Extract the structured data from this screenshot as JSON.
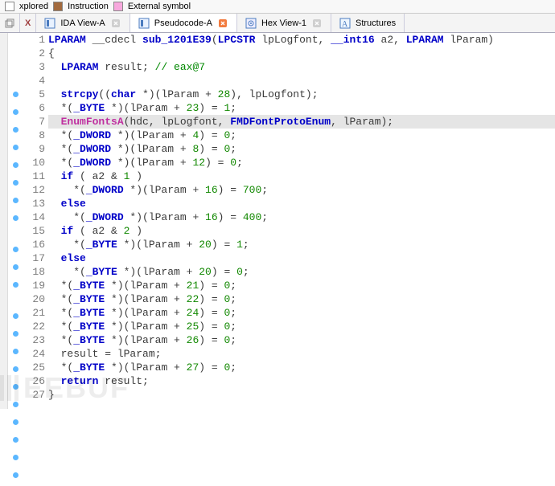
{
  "topbar": {
    "items": [
      {
        "color": "#ffffff",
        "label": "xplored"
      },
      {
        "color": "#a26a3e",
        "label": "Instruction"
      },
      {
        "color": "#f7a8dd",
        "label": "External symbol"
      }
    ]
  },
  "tabs": [
    {
      "id": "ida-view",
      "label": "IDA View-A",
      "icon": "blue",
      "close_color": "#cfcfcf",
      "active": false
    },
    {
      "id": "pseudocode",
      "label": "Pseudocode-A",
      "icon": "blue",
      "close_color": "#f27b3e",
      "active": true
    },
    {
      "id": "hex-view",
      "label": "Hex View-1",
      "icon": "target",
      "close_color": "#cfcfcf",
      "active": false
    },
    {
      "id": "structures",
      "label": "Structures",
      "icon": "struct",
      "close_color": "",
      "active": false
    }
  ],
  "left_extra_close": "X",
  "code": {
    "lines": [
      {
        "n": 1,
        "dot": false,
        "hl": false,
        "tokens": [
          [
            "fn",
            "LPARAM"
          ],
          [
            "txt",
            " __cdecl "
          ],
          [
            "fn",
            "sub_1201E39"
          ],
          [
            "txt",
            "("
          ],
          [
            "kw",
            "LPCSTR"
          ],
          [
            "txt",
            " "
          ],
          [
            "txt",
            "lpLogfont, "
          ],
          [
            "kw",
            "__int16"
          ],
          [
            "txt",
            " a2, "
          ],
          [
            "kw",
            "LPARAM"
          ],
          [
            "txt",
            " lParam)"
          ]
        ]
      },
      {
        "n": 2,
        "dot": false,
        "hl": false,
        "tokens": [
          [
            "txt",
            "{"
          ]
        ]
      },
      {
        "n": 3,
        "dot": false,
        "hl": false,
        "tokens": [
          [
            "txt",
            "  "
          ],
          [
            "kw",
            "LPARAM"
          ],
          [
            "txt",
            " result; "
          ],
          [
            "cmt",
            "// eax@7"
          ]
        ]
      },
      {
        "n": 4,
        "dot": false,
        "hl": false,
        "tokens": [
          [
            "txt",
            " "
          ]
        ]
      },
      {
        "n": 5,
        "dot": true,
        "hl": false,
        "tokens": [
          [
            "txt",
            "  "
          ],
          [
            "fn",
            "strcpy"
          ],
          [
            "txt",
            "(("
          ],
          [
            "kw",
            "char"
          ],
          [
            "txt",
            " *)(lParam + "
          ],
          [
            "num",
            "28"
          ],
          [
            "txt",
            "), lpLogfont);"
          ]
        ]
      },
      {
        "n": 6,
        "dot": true,
        "hl": false,
        "tokens": [
          [
            "txt",
            "  *("
          ],
          [
            "kwt",
            "_BYTE"
          ],
          [
            "txt",
            " *)(lParam + "
          ],
          [
            "num",
            "23"
          ],
          [
            "txt",
            ") = "
          ],
          [
            "num",
            "1"
          ],
          [
            "txt",
            ";"
          ]
        ]
      },
      {
        "n": 7,
        "dot": true,
        "hl": true,
        "tokens": [
          [
            "txt",
            "  "
          ],
          [
            "ext",
            "EnumFontsA"
          ],
          [
            "txt",
            "("
          ],
          [
            "txt",
            "hdc"
          ],
          [
            "txt",
            ", lpLogfont, "
          ],
          [
            "fn",
            "FMDFontProtoEnum"
          ],
          [
            "txt",
            ", lParam);"
          ]
        ]
      },
      {
        "n": 8,
        "dot": true,
        "hl": false,
        "tokens": [
          [
            "txt",
            "  *("
          ],
          [
            "kwt",
            "_DWORD"
          ],
          [
            "txt",
            " *)(lParam + "
          ],
          [
            "num",
            "4"
          ],
          [
            "txt",
            ") = "
          ],
          [
            "num",
            "0"
          ],
          [
            "txt",
            ";"
          ]
        ]
      },
      {
        "n": 9,
        "dot": true,
        "hl": false,
        "tokens": [
          [
            "txt",
            "  *("
          ],
          [
            "kwt",
            "_DWORD"
          ],
          [
            "txt",
            " *)(lParam + "
          ],
          [
            "num",
            "8"
          ],
          [
            "txt",
            ") = "
          ],
          [
            "num",
            "0"
          ],
          [
            "txt",
            ";"
          ]
        ]
      },
      {
        "n": 10,
        "dot": true,
        "hl": false,
        "tokens": [
          [
            "txt",
            "  *("
          ],
          [
            "kwt",
            "_DWORD"
          ],
          [
            "txt",
            " *)(lParam + "
          ],
          [
            "num",
            "12"
          ],
          [
            "txt",
            ") = "
          ],
          [
            "num",
            "0"
          ],
          [
            "txt",
            ";"
          ]
        ]
      },
      {
        "n": 11,
        "dot": true,
        "hl": false,
        "tokens": [
          [
            "txt",
            "  "
          ],
          [
            "kw",
            "if"
          ],
          [
            "txt",
            " ( a2 & "
          ],
          [
            "num",
            "1"
          ],
          [
            "txt",
            " )"
          ]
        ]
      },
      {
        "n": 12,
        "dot": true,
        "hl": false,
        "tokens": [
          [
            "txt",
            "    *("
          ],
          [
            "kwt",
            "_DWORD"
          ],
          [
            "txt",
            " *)(lParam + "
          ],
          [
            "num",
            "16"
          ],
          [
            "txt",
            ") = "
          ],
          [
            "num",
            "700"
          ],
          [
            "txt",
            ";"
          ]
        ]
      },
      {
        "n": 13,
        "dot": false,
        "hl": false,
        "tokens": [
          [
            "txt",
            "  "
          ],
          [
            "kw",
            "else"
          ]
        ]
      },
      {
        "n": 14,
        "dot": true,
        "hl": false,
        "tokens": [
          [
            "txt",
            "    *("
          ],
          [
            "kwt",
            "_DWORD"
          ],
          [
            "txt",
            " *)(lParam + "
          ],
          [
            "num",
            "16"
          ],
          [
            "txt",
            ") = "
          ],
          [
            "num",
            "400"
          ],
          [
            "txt",
            ";"
          ]
        ]
      },
      {
        "n": 15,
        "dot": true,
        "hl": false,
        "tokens": [
          [
            "txt",
            "  "
          ],
          [
            "kw",
            "if"
          ],
          [
            "txt",
            " ( a2 & "
          ],
          [
            "num",
            "2"
          ],
          [
            "txt",
            " )"
          ]
        ]
      },
      {
        "n": 16,
        "dot": true,
        "hl": false,
        "tokens": [
          [
            "txt",
            "    *("
          ],
          [
            "kwt",
            "_BYTE"
          ],
          [
            "txt",
            " *)(lParam + "
          ],
          [
            "num",
            "20"
          ],
          [
            "txt",
            ") = "
          ],
          [
            "num",
            "1"
          ],
          [
            "txt",
            ";"
          ]
        ]
      },
      {
        "n": 17,
        "dot": false,
        "hl": false,
        "tokens": [
          [
            "txt",
            "  "
          ],
          [
            "kw",
            "else"
          ]
        ]
      },
      {
        "n": 18,
        "dot": true,
        "hl": false,
        "tokens": [
          [
            "txt",
            "    *("
          ],
          [
            "kwt",
            "_BYTE"
          ],
          [
            "txt",
            " *)(lParam + "
          ],
          [
            "num",
            "20"
          ],
          [
            "txt",
            ") = "
          ],
          [
            "num",
            "0"
          ],
          [
            "txt",
            ";"
          ]
        ]
      },
      {
        "n": 19,
        "dot": true,
        "hl": false,
        "tokens": [
          [
            "txt",
            "  *("
          ],
          [
            "kwt",
            "_BYTE"
          ],
          [
            "txt",
            " *)(lParam + "
          ],
          [
            "num",
            "21"
          ],
          [
            "txt",
            ") = "
          ],
          [
            "num",
            "0"
          ],
          [
            "txt",
            ";"
          ]
        ]
      },
      {
        "n": 20,
        "dot": true,
        "hl": false,
        "tokens": [
          [
            "txt",
            "  *("
          ],
          [
            "kwt",
            "_BYTE"
          ],
          [
            "txt",
            " *)(lParam + "
          ],
          [
            "num",
            "22"
          ],
          [
            "txt",
            ") = "
          ],
          [
            "num",
            "0"
          ],
          [
            "txt",
            ";"
          ]
        ]
      },
      {
        "n": 21,
        "dot": true,
        "hl": false,
        "tokens": [
          [
            "txt",
            "  *("
          ],
          [
            "kwt",
            "_BYTE"
          ],
          [
            "txt",
            " *)(lParam + "
          ],
          [
            "num",
            "24"
          ],
          [
            "txt",
            ") = "
          ],
          [
            "num",
            "0"
          ],
          [
            "txt",
            ";"
          ]
        ]
      },
      {
        "n": 22,
        "dot": true,
        "hl": false,
        "tokens": [
          [
            "txt",
            "  *("
          ],
          [
            "kwt",
            "_BYTE"
          ],
          [
            "txt",
            " *)(lParam + "
          ],
          [
            "num",
            "25"
          ],
          [
            "txt",
            ") = "
          ],
          [
            "num",
            "0"
          ],
          [
            "txt",
            ";"
          ]
        ]
      },
      {
        "n": 23,
        "dot": true,
        "hl": false,
        "tokens": [
          [
            "txt",
            "  *("
          ],
          [
            "kwt",
            "_BYTE"
          ],
          [
            "txt",
            " *)(lParam + "
          ],
          [
            "num",
            "26"
          ],
          [
            "txt",
            ") = "
          ],
          [
            "num",
            "0"
          ],
          [
            "txt",
            ";"
          ]
        ]
      },
      {
        "n": 24,
        "dot": true,
        "hl": false,
        "tokens": [
          [
            "txt",
            "  result = lParam;"
          ]
        ]
      },
      {
        "n": 25,
        "dot": true,
        "hl": false,
        "tokens": [
          [
            "txt",
            "  *("
          ],
          [
            "kwt",
            "_BYTE"
          ],
          [
            "txt",
            " *)(lParam + "
          ],
          [
            "num",
            "27"
          ],
          [
            "txt",
            ") = "
          ],
          [
            "num",
            "0"
          ],
          [
            "txt",
            ";"
          ]
        ]
      },
      {
        "n": 26,
        "dot": true,
        "hl": false,
        "tokens": [
          [
            "txt",
            "  "
          ],
          [
            "kw",
            "return"
          ],
          [
            "txt",
            " result;"
          ]
        ]
      },
      {
        "n": 27,
        "dot": true,
        "hl": false,
        "tokens": [
          [
            "txt",
            "}"
          ]
        ]
      }
    ]
  },
  "watermark": "EEBUF"
}
